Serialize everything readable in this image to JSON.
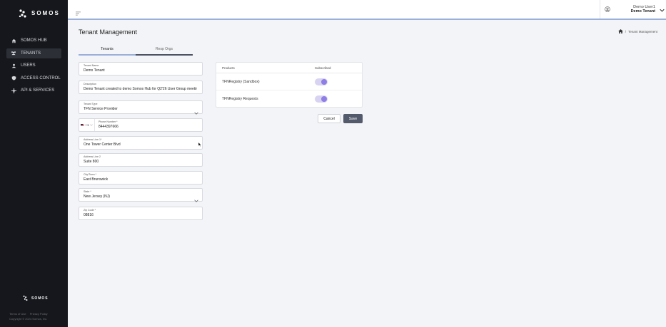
{
  "brand": {
    "name": "SOMOS",
    "footer_name": "SOMOS"
  },
  "sidebar": {
    "items": [
      {
        "label": "SOMOS HUB",
        "icon": "home-icon"
      },
      {
        "label": "TENANTS",
        "icon": "users-group-icon",
        "active": true
      },
      {
        "label": "USERS",
        "icon": "user-icon"
      },
      {
        "label": "ACCESS CONTROL",
        "icon": "shield-icon"
      },
      {
        "label": "API & SERVICES",
        "icon": "plug-icon"
      }
    ],
    "footer": {
      "terms": "Terms of Use",
      "privacy": "Privacy Policy",
      "copyright": "Copyright © 2024 Somos, Inc."
    }
  },
  "topbar": {
    "user_name": "Demo User1",
    "tenant_name": "Demo Tenant"
  },
  "page": {
    "title": "Tenant Management",
    "breadcrumb": "Tenant Management"
  },
  "tabs": [
    {
      "label": "Tenants",
      "active": true
    },
    {
      "label": "Resp Orgs",
      "active": false
    }
  ],
  "form": {
    "tenant_name": {
      "label": "Tenant Name",
      "value": "Demo Tenant"
    },
    "description": {
      "label": "Description",
      "value": "Demo Tenant created to demo Somos Hub for Q2'26 User Group meetir"
    },
    "tenant_type": {
      "label": "Tenant Type",
      "value": "TFN Service Provider"
    },
    "phone": {
      "country_code": "+1",
      "label": "Phone Number *",
      "value": "8444397666"
    },
    "address1": {
      "label": "Address Line 1*",
      "value": "One Tower Center Blvd"
    },
    "address2": {
      "label": "Address Line 2",
      "value": "Suite 800"
    },
    "city": {
      "label": "City/Town *",
      "value": "East Brunswick"
    },
    "state": {
      "label": "State *",
      "value": "New Jersey (NJ)"
    },
    "zip": {
      "label": "Zip Code *",
      "value": "08816"
    }
  },
  "products": {
    "header_product": "Products",
    "header_subscribed": "Subscribed",
    "rows": [
      {
        "name": "TFNRegistry (Sandbox)",
        "subscribed": true
      },
      {
        "name": "TFNRegistry Requests",
        "subscribed": true
      }
    ]
  },
  "actions": {
    "cancel": "Cancel",
    "save": "Save"
  },
  "colors": {
    "sidebar_bg": "#15171c",
    "accent": "#9ab0d8",
    "toggle_on": "#8f7ee6",
    "save_bg": "#535a6b"
  }
}
